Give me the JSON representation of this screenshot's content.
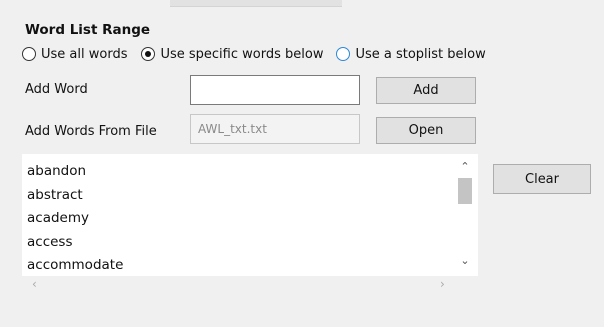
{
  "section": {
    "title": "Word List Range"
  },
  "range_options": [
    {
      "label": "Use all words"
    },
    {
      "label": "Use specific words below"
    },
    {
      "label": "Use a stoplist below"
    }
  ],
  "add_word": {
    "label": "Add Word",
    "value": "",
    "button_label": "Add"
  },
  "add_from_file": {
    "label": "Add Words From File",
    "file_value": "AWL_txt.txt",
    "button_label": "Open"
  },
  "word_list": {
    "items": [
      "abandon",
      "abstract",
      "academy",
      "access",
      "accommodate"
    ],
    "clear_label": "Clear"
  },
  "icons": {
    "scroll_up": "chevron-up",
    "scroll_down": "chevron-down",
    "scroll_left": "chevron-left",
    "scroll_right": "chevron-right"
  }
}
